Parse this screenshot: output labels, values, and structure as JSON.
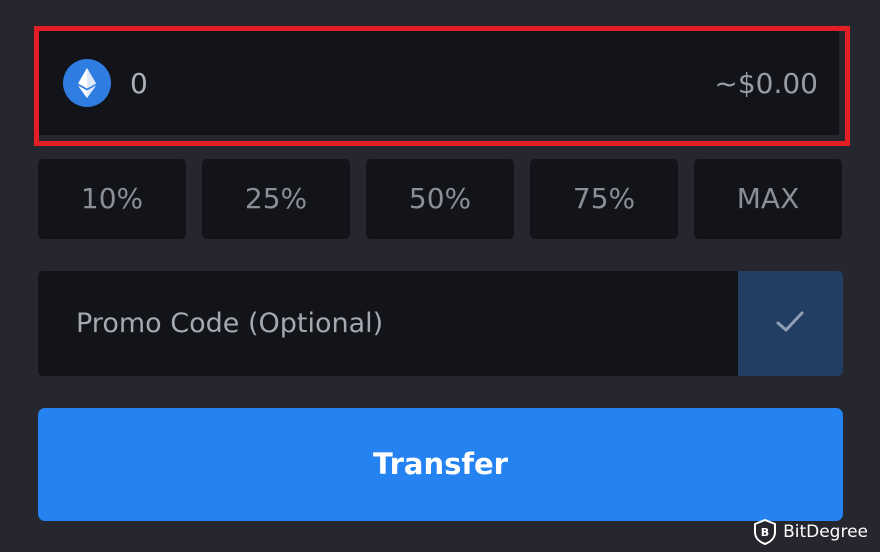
{
  "amount": {
    "value": "0",
    "fiat_value": "~$0.00",
    "currency_icon": "ethereum-icon",
    "highlight_color": "#e41e26"
  },
  "percent_buttons": [
    "10%",
    "25%",
    "50%",
    "75%",
    "MAX"
  ],
  "promo": {
    "placeholder": "Promo Code (Optional)",
    "apply_icon": "check-icon"
  },
  "transfer": {
    "label": "Transfer",
    "color": "#2483f0"
  },
  "watermark": {
    "text": "BitDegree",
    "icon": "bitdegree-shield-icon"
  }
}
